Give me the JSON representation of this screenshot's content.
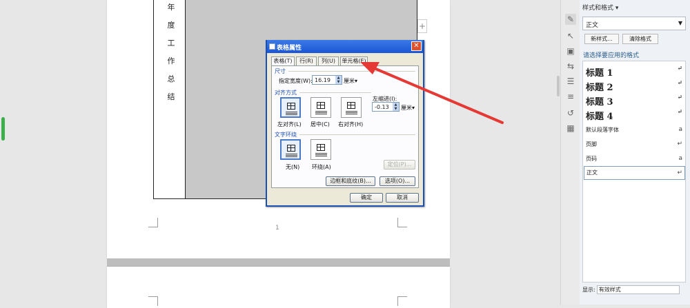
{
  "document": {
    "vertical_text": [
      "年",
      "度",
      "工",
      "作",
      "总",
      "结"
    ],
    "page_number": "1",
    "add_button": "+"
  },
  "dialog": {
    "title": "表格属性",
    "close": "✕",
    "tabs": [
      "表格(T)",
      "行(R)",
      "列(U)",
      "单元格(E)"
    ],
    "size_section": "尺寸",
    "width_label": "指定宽度(W):",
    "width_value": "16.19",
    "width_unit": "厘米▾",
    "align_section": "对齐方式",
    "align_options": [
      "左对齐(L)",
      "居中(C)",
      "右对齐(H)"
    ],
    "indent_label": "左缩进(I):",
    "indent_value": "-0.13",
    "indent_unit": "厘米▾",
    "wrap_section": "文字环绕",
    "wrap_options": [
      "无(N)",
      "环绕(A)"
    ],
    "position_button": "定位(P)...",
    "borders_button": "边框和底纹(B)...",
    "options_button": "选项(O)...",
    "ok_button": "确定",
    "cancel_button": "取消"
  },
  "panel": {
    "title": "样式和格式 ▾",
    "current_style": "正文",
    "new_style": "新样式...",
    "clear_format": "清除格式",
    "hint": "请选择要应用的格式",
    "styles": [
      {
        "label": "标题 1",
        "mark": "↵"
      },
      {
        "label": "标题 2",
        "mark": "↵"
      },
      {
        "label": "标题 3",
        "mark": "↵"
      },
      {
        "label": "标题 4",
        "mark": "↵"
      },
      {
        "label": "默认段落字体",
        "mark": "a"
      },
      {
        "label": "页脚",
        "mark": "↵"
      },
      {
        "label": "页码",
        "mark": "a"
      },
      {
        "label": "正文",
        "mark": "↵"
      }
    ],
    "show_label": "显示:",
    "show_value": "有效样式"
  },
  "colors": {
    "accent_green": "#3cae4a",
    "dialog_title_blue": "#1a56d6",
    "arrow_red": "#e53935"
  }
}
